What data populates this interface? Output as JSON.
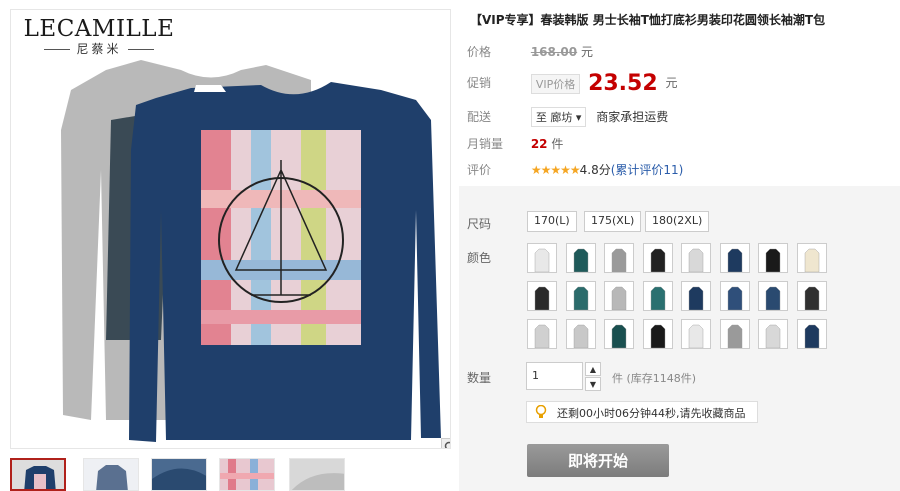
{
  "brand": {
    "name": "LECAMILLE",
    "sub": "尼蔡米"
  },
  "product": {
    "title": "【VIP专享】春装韩版 男士长袖T恤打底衫男装印花圆领长袖潮T包",
    "price_label": "价格",
    "price_original": "168.00",
    "currency_unit": "元",
    "promo_label": "促销",
    "vip_badge": "VIP价格",
    "promo_price": "23.52",
    "shipping_label": "配送",
    "shipping_from": "至 廊坊",
    "shipping_note": "商家承担运费",
    "monthly_label": "月销量",
    "monthly_value": "22",
    "monthly_unit": "件",
    "rating_label": "评价",
    "rating_stars": "★★★★★",
    "rating_score": "4.8分",
    "rating_count": "(累计评价11)"
  },
  "options": {
    "size_label": "尺码",
    "sizes": [
      "170(L)",
      "175(XL)",
      "180(2XL)"
    ],
    "color_label": "颜色",
    "color_colors": [
      "#e8e8e8",
      "#1f5a5a",
      "#9a9a9a",
      "#222222",
      "#d8d8d8",
      "#1e3a5f",
      "#1a1a1a",
      "#efe6cf",
      "#2a2a2a",
      "#2b6b6b",
      "#b8b8b8",
      "#2a7070",
      "#1e3a5f",
      "#2f4f7a",
      "#2a4a70",
      "#303030",
      "#d0d0d0",
      "#c8c8c8",
      "#1a5050",
      "#1a1a1a",
      "#e8e8e8",
      "#9a9a9a",
      "#d8d8d8",
      "#1e3a5f"
    ],
    "qty_label": "数量",
    "qty_value": "1",
    "qty_unit": "件",
    "stock": "(库存1148件)",
    "notice": "还剩00小时06分钟44秒,请先收藏商品",
    "start_button": "即将开始"
  },
  "colors": {
    "accent": "#c40000",
    "link": "#2a5caa",
    "panel": "#f4f4f4"
  }
}
